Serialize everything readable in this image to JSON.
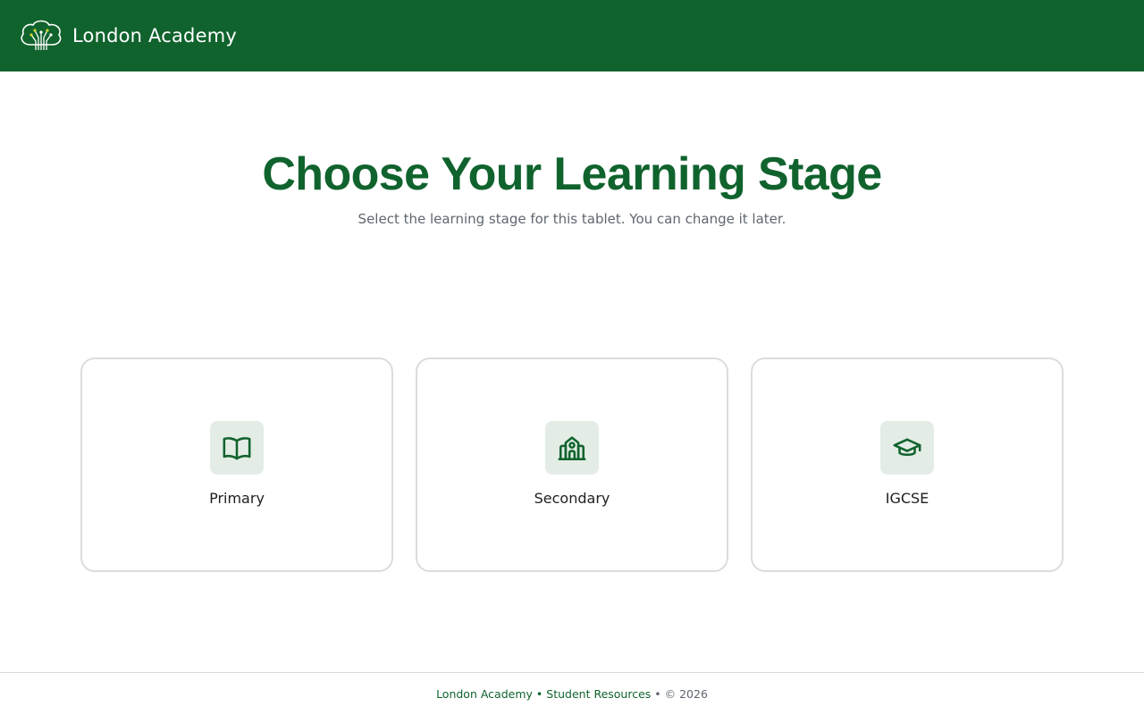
{
  "header": {
    "brand": "London Academy",
    "logo_icon": "tree-circuit-logo-icon"
  },
  "hero": {
    "title": "Choose Your Learning Stage",
    "subtitle": "Select the learning stage for this tablet. You can change it later."
  },
  "stages": [
    {
      "label": "Primary",
      "icon": "open-book-icon"
    },
    {
      "label": "Secondary",
      "icon": "school-building-icon"
    },
    {
      "label": "IGCSE",
      "icon": "graduation-cap-icon"
    }
  ],
  "footer": {
    "brand_link": "London Academy",
    "separator": "•",
    "resources_link": "Student Resources",
    "copyright": "• © 2026"
  },
  "colors": {
    "brand_green": "#10632d",
    "icon_bg": "#e3ece5",
    "card_border": "#dcdcdc",
    "muted_text": "#5f6670"
  }
}
